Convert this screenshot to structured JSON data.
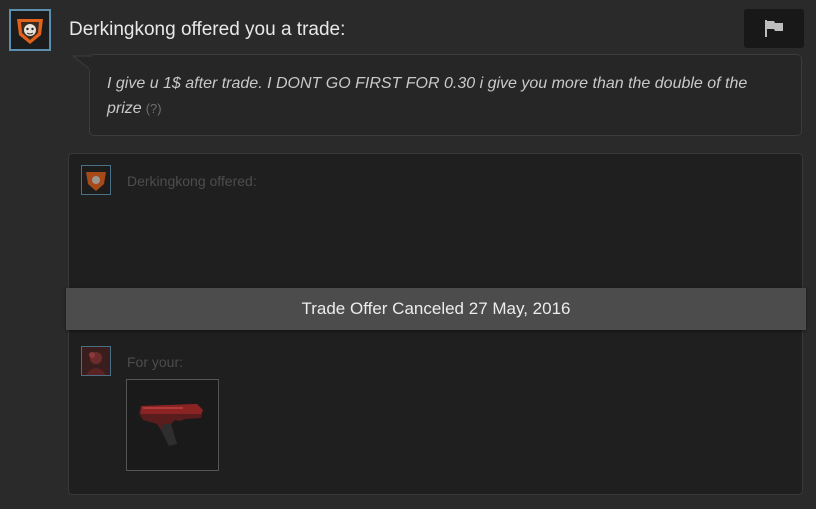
{
  "header": {
    "title": "Derkingkong offered you a trade:",
    "avatar_icon": "orange-bulldog-avatar-icon",
    "report_icon": "flag-icon"
  },
  "message": {
    "text": "I give u 1$ after trade. I DONT GO FIRST FOR 0.30 i give you more than the double of the prize",
    "help": "(?)"
  },
  "trade": {
    "offered_label": "Derkingkong offered:",
    "status_banner": "Trade Offer Canceled 27 May, 2016",
    "for_your_label": "For your:",
    "item_icon": "red-pistol-icon"
  },
  "colors": {
    "background": "#2a2a2a",
    "avatar_border": "#5b8fb0",
    "banner": "#4c4c4c",
    "accent_orange": "#e0621c"
  }
}
